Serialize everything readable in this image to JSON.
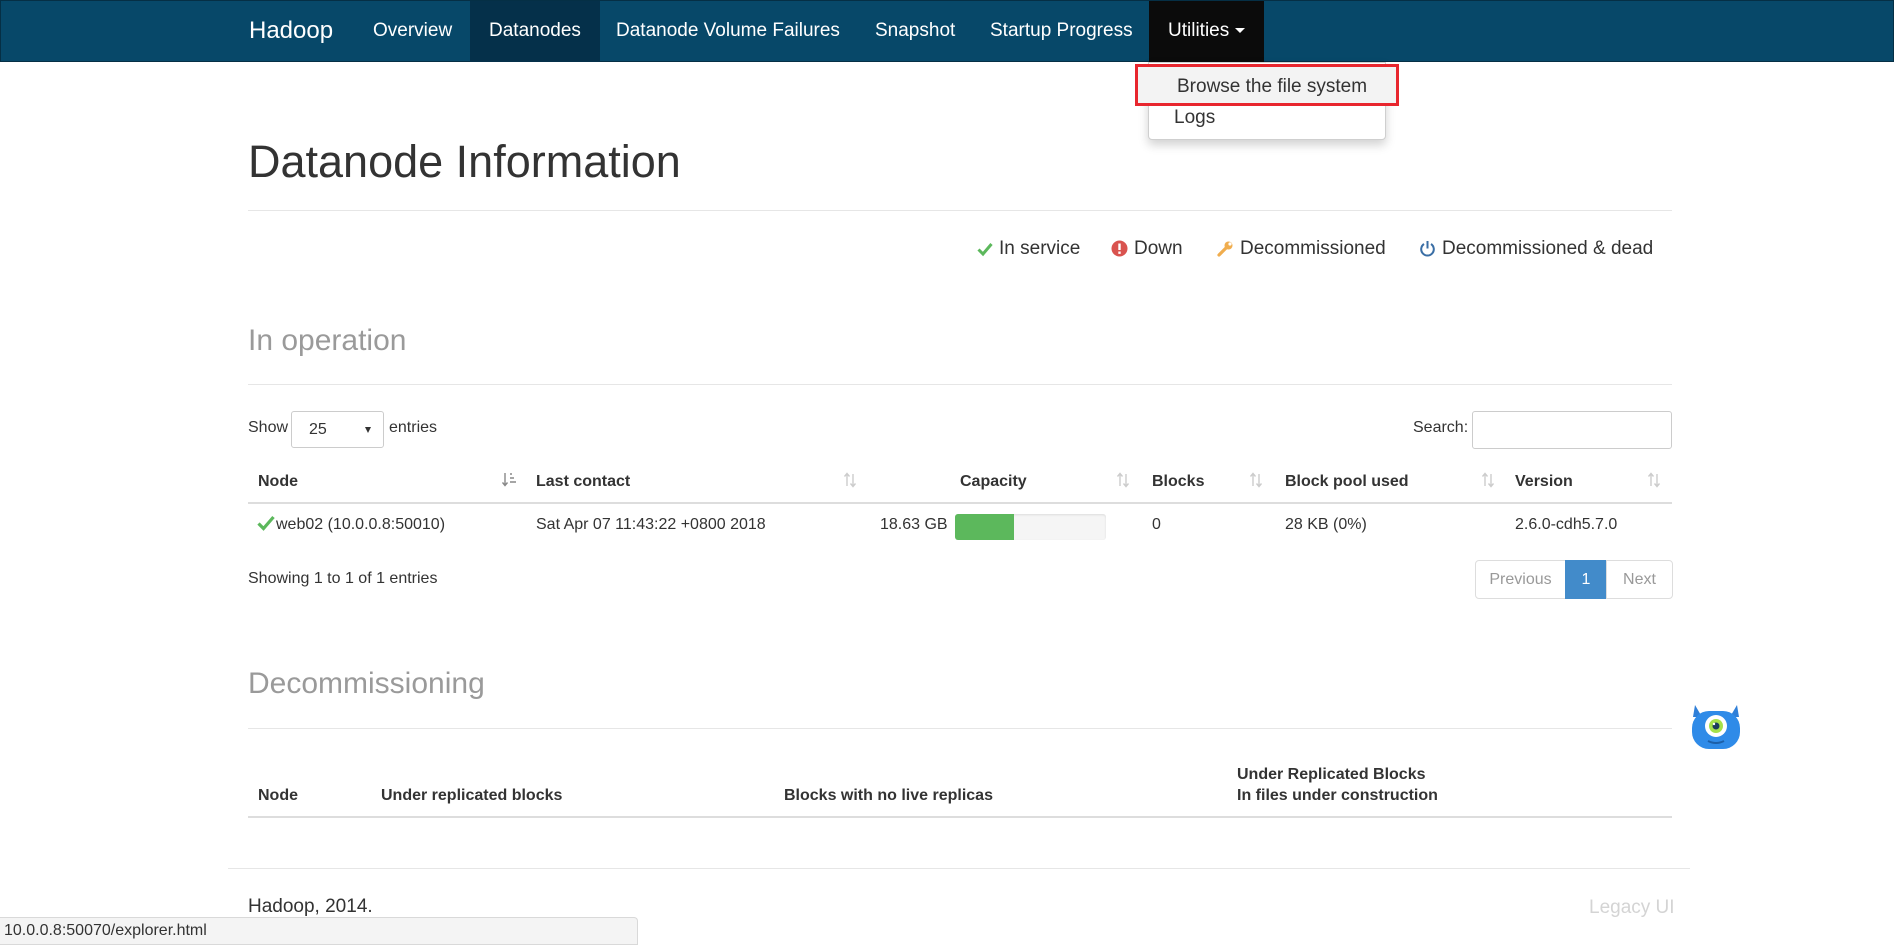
{
  "navbar": {
    "brand": "Hadoop",
    "items": [
      {
        "label": "Overview"
      },
      {
        "label": "Datanodes"
      },
      {
        "label": "Datanode Volume Failures"
      },
      {
        "label": "Snapshot"
      },
      {
        "label": "Startup Progress"
      },
      {
        "label": "Utilities"
      }
    ],
    "active": "Datanodes"
  },
  "utilities_menu": {
    "items": [
      {
        "label": "Browse the file system"
      },
      {
        "label": "Logs"
      }
    ],
    "highlighted": "Browse the file system"
  },
  "page_title": "Datanode Information",
  "legend": [
    {
      "icon": "check-icon",
      "label": "In service",
      "color": "#5cb85c"
    },
    {
      "icon": "exclamation-circle-icon",
      "label": "Down",
      "color": "#d9534f"
    },
    {
      "icon": "wrench-icon",
      "label": "Decommissioned",
      "color": "#f0ad4e"
    },
    {
      "icon": "power-icon",
      "label": "Decommissioned & dead",
      "color": "#3a6ea5"
    }
  ],
  "in_operation": {
    "title": "In operation",
    "show_label": "Show",
    "entries_label": "entries",
    "page_size": "25",
    "search_label": "Search:",
    "search_value": "",
    "columns": [
      "Node",
      "Last contact",
      "Capacity",
      "Blocks",
      "Block pool used",
      "Version"
    ],
    "rows": [
      {
        "node": "web02 (10.0.0.8:50010)",
        "last_contact": "Sat Apr 07 11:43:22 +0800 2018",
        "capacity": "18.63 GB",
        "capacity_used_fraction": 0.39,
        "blocks": "0",
        "block_pool_used": "28 KB (0%)",
        "version": "2.6.0-cdh5.7.0"
      }
    ],
    "info": "Showing 1 to 1 of 1 entries",
    "pagination": {
      "previous": "Previous",
      "current": "1",
      "next": "Next"
    }
  },
  "decommissioning": {
    "title": "Decommissioning",
    "columns": [
      "Node",
      "Under replicated blocks",
      "Blocks with no live replicas",
      "Under Replicated Blocks",
      "In files under construction"
    ]
  },
  "footer": {
    "copyright": "Hadoop, 2014.",
    "legacy_link": "Legacy UI"
  },
  "status_bar": {
    "url": "10.0.0.8:50070/explorer.html"
  },
  "colors": {
    "navbar": "#074869",
    "accent": "#428bca",
    "progress": "#5cb85c",
    "highlight_box": "#e8262e"
  }
}
